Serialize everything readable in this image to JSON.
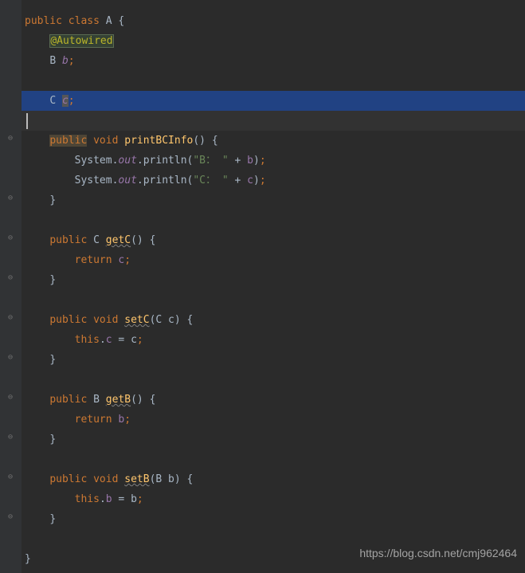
{
  "code": {
    "l1": {
      "kw1": "public",
      "kw2": "class",
      "cls": "A",
      "brace": "{"
    },
    "l2": {
      "ann": "@Autowired"
    },
    "l3": {
      "type": "B",
      "field": "b",
      "semi": ";"
    },
    "l5": {
      "type": "C",
      "field": "c",
      "semi": ";"
    },
    "l7": {
      "kw1": "public",
      "kw2": "void",
      "meth": "printBCInfo",
      "parens": "()",
      "brace": "{"
    },
    "l8": {
      "sys": "System.",
      "out": "out",
      "print": ".println",
      "lp": "(",
      "str": "\"B： \"",
      "plus": " + ",
      "var": "b",
      "rp": ")",
      "semi": ";"
    },
    "l9": {
      "sys": "System.",
      "out": "out",
      "print": ".println",
      "lp": "(",
      "str": "\"C： \"",
      "plus": " + ",
      "var": "c",
      "rp": ")",
      "semi": ";"
    },
    "l10": {
      "brace": "}"
    },
    "l12": {
      "kw1": "public",
      "type": "C",
      "meth": "getC",
      "parens": "()",
      "brace": "{"
    },
    "l13": {
      "kw": "return",
      "var": "c",
      "semi": ";"
    },
    "l14": {
      "brace": "}"
    },
    "l16": {
      "kw1": "public",
      "kw2": "void",
      "meth": "setC",
      "lp": "(",
      "ptype": "C",
      "pname": "c",
      "rp": ")",
      "brace": "{"
    },
    "l17": {
      "kw": "this",
      "dot": ".",
      "field": "c",
      "eq": " = ",
      "var": "c",
      "semi": ";"
    },
    "l18": {
      "brace": "}"
    },
    "l20": {
      "kw1": "public",
      "type": "B",
      "meth": "getB",
      "parens": "()",
      "brace": "{"
    },
    "l21": {
      "kw": "return",
      "var": "b",
      "semi": ";"
    },
    "l22": {
      "brace": "}"
    },
    "l24": {
      "kw1": "public",
      "kw2": "void",
      "meth": "setB",
      "lp": "(",
      "ptype": "B",
      "pname": "b",
      "rp": ")",
      "brace": "{"
    },
    "l25": {
      "kw": "this",
      "dot": ".",
      "field": "b",
      "eq": " = ",
      "var": "b",
      "semi": ";"
    },
    "l26": {
      "brace": "}"
    },
    "l28": {
      "brace": "}"
    }
  },
  "watermark": "https://blog.csdn.net/cmj962464"
}
